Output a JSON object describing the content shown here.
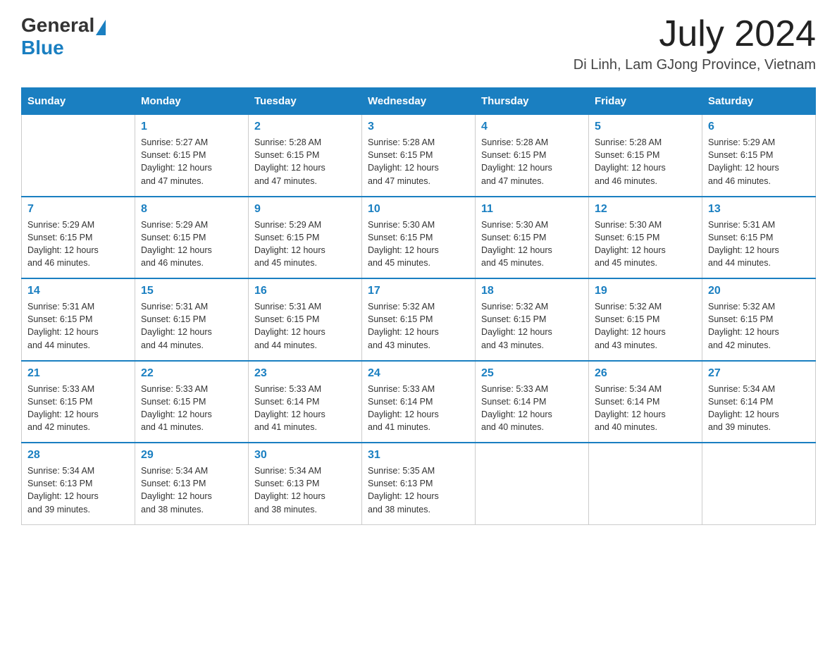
{
  "header": {
    "logo_general": "General",
    "logo_blue": "Blue",
    "month_title": "July 2024",
    "location": "Di Linh, Lam GJong Province, Vietnam"
  },
  "weekdays": [
    "Sunday",
    "Monday",
    "Tuesday",
    "Wednesday",
    "Thursday",
    "Friday",
    "Saturday"
  ],
  "weeks": [
    {
      "days": [
        {
          "num": "",
          "info": ""
        },
        {
          "num": "1",
          "info": "Sunrise: 5:27 AM\nSunset: 6:15 PM\nDaylight: 12 hours\nand 47 minutes."
        },
        {
          "num": "2",
          "info": "Sunrise: 5:28 AM\nSunset: 6:15 PM\nDaylight: 12 hours\nand 47 minutes."
        },
        {
          "num": "3",
          "info": "Sunrise: 5:28 AM\nSunset: 6:15 PM\nDaylight: 12 hours\nand 47 minutes."
        },
        {
          "num": "4",
          "info": "Sunrise: 5:28 AM\nSunset: 6:15 PM\nDaylight: 12 hours\nand 47 minutes."
        },
        {
          "num": "5",
          "info": "Sunrise: 5:28 AM\nSunset: 6:15 PM\nDaylight: 12 hours\nand 46 minutes."
        },
        {
          "num": "6",
          "info": "Sunrise: 5:29 AM\nSunset: 6:15 PM\nDaylight: 12 hours\nand 46 minutes."
        }
      ]
    },
    {
      "days": [
        {
          "num": "7",
          "info": "Sunrise: 5:29 AM\nSunset: 6:15 PM\nDaylight: 12 hours\nand 46 minutes."
        },
        {
          "num": "8",
          "info": "Sunrise: 5:29 AM\nSunset: 6:15 PM\nDaylight: 12 hours\nand 46 minutes."
        },
        {
          "num": "9",
          "info": "Sunrise: 5:29 AM\nSunset: 6:15 PM\nDaylight: 12 hours\nand 45 minutes."
        },
        {
          "num": "10",
          "info": "Sunrise: 5:30 AM\nSunset: 6:15 PM\nDaylight: 12 hours\nand 45 minutes."
        },
        {
          "num": "11",
          "info": "Sunrise: 5:30 AM\nSunset: 6:15 PM\nDaylight: 12 hours\nand 45 minutes."
        },
        {
          "num": "12",
          "info": "Sunrise: 5:30 AM\nSunset: 6:15 PM\nDaylight: 12 hours\nand 45 minutes."
        },
        {
          "num": "13",
          "info": "Sunrise: 5:31 AM\nSunset: 6:15 PM\nDaylight: 12 hours\nand 44 minutes."
        }
      ]
    },
    {
      "days": [
        {
          "num": "14",
          "info": "Sunrise: 5:31 AM\nSunset: 6:15 PM\nDaylight: 12 hours\nand 44 minutes."
        },
        {
          "num": "15",
          "info": "Sunrise: 5:31 AM\nSunset: 6:15 PM\nDaylight: 12 hours\nand 44 minutes."
        },
        {
          "num": "16",
          "info": "Sunrise: 5:31 AM\nSunset: 6:15 PM\nDaylight: 12 hours\nand 44 minutes."
        },
        {
          "num": "17",
          "info": "Sunrise: 5:32 AM\nSunset: 6:15 PM\nDaylight: 12 hours\nand 43 minutes."
        },
        {
          "num": "18",
          "info": "Sunrise: 5:32 AM\nSunset: 6:15 PM\nDaylight: 12 hours\nand 43 minutes."
        },
        {
          "num": "19",
          "info": "Sunrise: 5:32 AM\nSunset: 6:15 PM\nDaylight: 12 hours\nand 43 minutes."
        },
        {
          "num": "20",
          "info": "Sunrise: 5:32 AM\nSunset: 6:15 PM\nDaylight: 12 hours\nand 42 minutes."
        }
      ]
    },
    {
      "days": [
        {
          "num": "21",
          "info": "Sunrise: 5:33 AM\nSunset: 6:15 PM\nDaylight: 12 hours\nand 42 minutes."
        },
        {
          "num": "22",
          "info": "Sunrise: 5:33 AM\nSunset: 6:15 PM\nDaylight: 12 hours\nand 41 minutes."
        },
        {
          "num": "23",
          "info": "Sunrise: 5:33 AM\nSunset: 6:14 PM\nDaylight: 12 hours\nand 41 minutes."
        },
        {
          "num": "24",
          "info": "Sunrise: 5:33 AM\nSunset: 6:14 PM\nDaylight: 12 hours\nand 41 minutes."
        },
        {
          "num": "25",
          "info": "Sunrise: 5:33 AM\nSunset: 6:14 PM\nDaylight: 12 hours\nand 40 minutes."
        },
        {
          "num": "26",
          "info": "Sunrise: 5:34 AM\nSunset: 6:14 PM\nDaylight: 12 hours\nand 40 minutes."
        },
        {
          "num": "27",
          "info": "Sunrise: 5:34 AM\nSunset: 6:14 PM\nDaylight: 12 hours\nand 39 minutes."
        }
      ]
    },
    {
      "days": [
        {
          "num": "28",
          "info": "Sunrise: 5:34 AM\nSunset: 6:13 PM\nDaylight: 12 hours\nand 39 minutes."
        },
        {
          "num": "29",
          "info": "Sunrise: 5:34 AM\nSunset: 6:13 PM\nDaylight: 12 hours\nand 38 minutes."
        },
        {
          "num": "30",
          "info": "Sunrise: 5:34 AM\nSunset: 6:13 PM\nDaylight: 12 hours\nand 38 minutes."
        },
        {
          "num": "31",
          "info": "Sunrise: 5:35 AM\nSunset: 6:13 PM\nDaylight: 12 hours\nand 38 minutes."
        },
        {
          "num": "",
          "info": ""
        },
        {
          "num": "",
          "info": ""
        },
        {
          "num": "",
          "info": ""
        }
      ]
    }
  ]
}
